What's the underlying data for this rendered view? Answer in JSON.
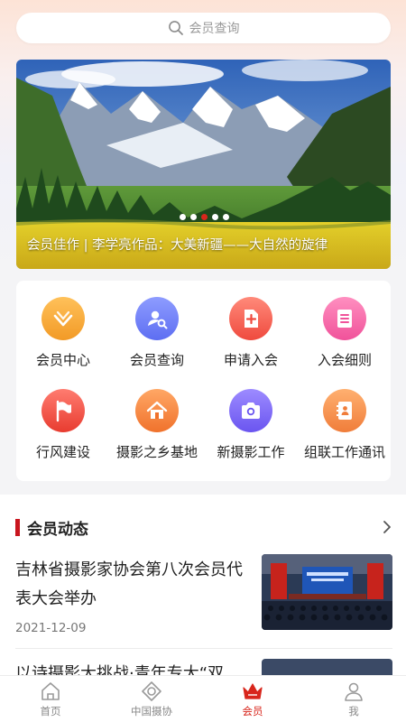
{
  "search": {
    "placeholder": "会员查询"
  },
  "banner": {
    "caption": "会员佳作 | 李学亮作品：大美新疆——大自然的旋律",
    "dots_total": 5,
    "active_dot_index": 2
  },
  "grid": {
    "items": [
      {
        "label": "会员中心",
        "icon": "diamond-icon",
        "color_top": "#ffc15a",
        "color_bottom": "#f29a26"
      },
      {
        "label": "会员查询",
        "icon": "member-search-icon",
        "color_top": "#8e9cff",
        "color_bottom": "#5d6ef2"
      },
      {
        "label": "申请入会",
        "icon": "add-document-icon",
        "color_top": "#ff8a7a",
        "color_bottom": "#ef4a3e"
      },
      {
        "label": "入会细则",
        "icon": "list-document-icon",
        "color_top": "#ff8fc0",
        "color_bottom": "#f0529a"
      },
      {
        "label": "行风建设",
        "icon": "flag-icon",
        "color_top": "#ff7c70",
        "color_bottom": "#e83c30"
      },
      {
        "label": "摄影之乡基地",
        "icon": "home-icon",
        "color_top": "#ffa765",
        "color_bottom": "#f0722c"
      },
      {
        "label": "新摄影工作",
        "icon": "camera-icon",
        "color_top": "#9d8bff",
        "color_bottom": "#6a55f0"
      },
      {
        "label": "组联工作通讯",
        "icon": "contacts-icon",
        "color_top": "#ffb070",
        "color_bottom": "#f07d3a"
      }
    ]
  },
  "news": {
    "section_title": "会员动态",
    "items": [
      {
        "title": "吉林省摄影家协会第八次会员代表大会举办",
        "date": "2021-12-09"
      },
      {
        "title": "以诗摄影大挑战·青年专大“双",
        "date": ""
      }
    ]
  },
  "tabbar": {
    "tabs": [
      {
        "label": "首页",
        "icon": "home-tab-icon"
      },
      {
        "label": "中国摄协",
        "icon": "association-tab-icon"
      },
      {
        "label": "会员",
        "icon": "crown-tab-icon",
        "active": true
      },
      {
        "label": "我",
        "icon": "profile-tab-icon"
      }
    ]
  },
  "colors": {
    "accent": "#d8261c",
    "section_bar": "#c9151e"
  }
}
